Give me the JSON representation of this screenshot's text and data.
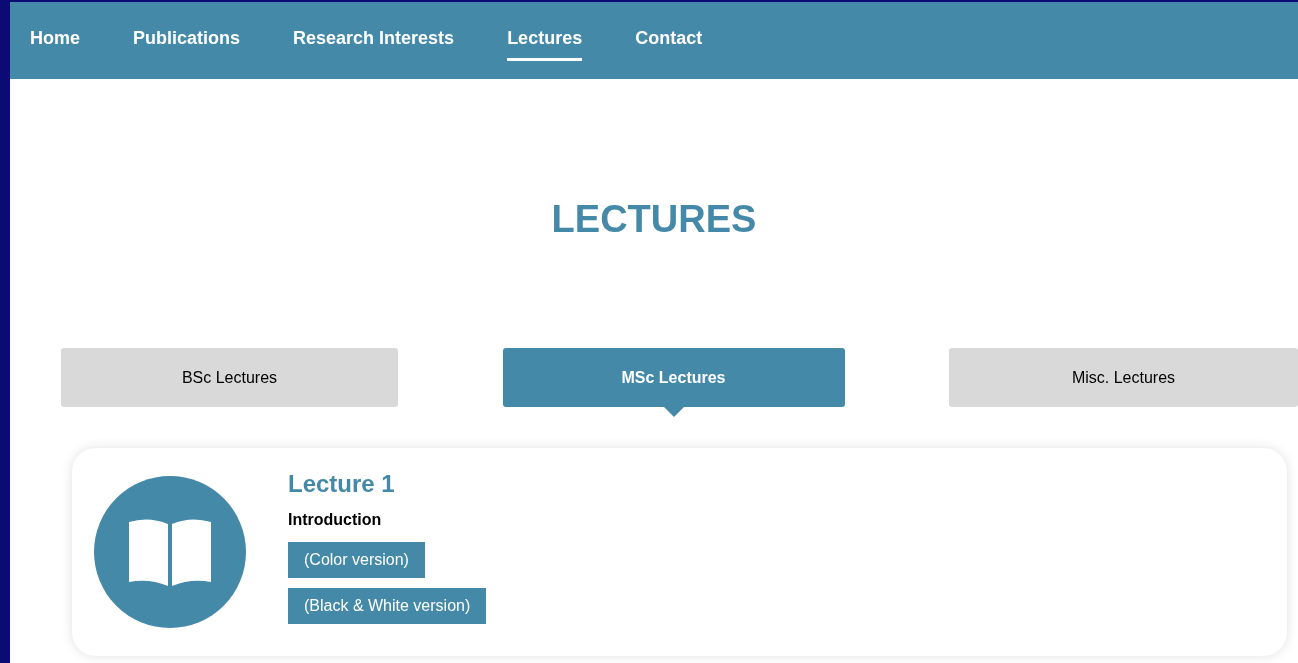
{
  "nav": [
    {
      "label": "Home",
      "selected": false
    },
    {
      "label": "Publications",
      "selected": false
    },
    {
      "label": "Research Interests",
      "selected": false
    },
    {
      "label": "Lectures",
      "selected": true
    },
    {
      "label": "Contact",
      "selected": false
    }
  ],
  "heading": "LECTURES",
  "tabs": [
    {
      "label": "BSc Lectures",
      "selected": false
    },
    {
      "label": "MSc Lectures",
      "selected": true
    },
    {
      "label": "Misc. Lectures",
      "selected": false
    }
  ],
  "lectures": [
    {
      "title": "Lecture 1",
      "subtitle": "Introduction",
      "links": [
        "(Color version)",
        "(Black & White version)"
      ]
    }
  ]
}
